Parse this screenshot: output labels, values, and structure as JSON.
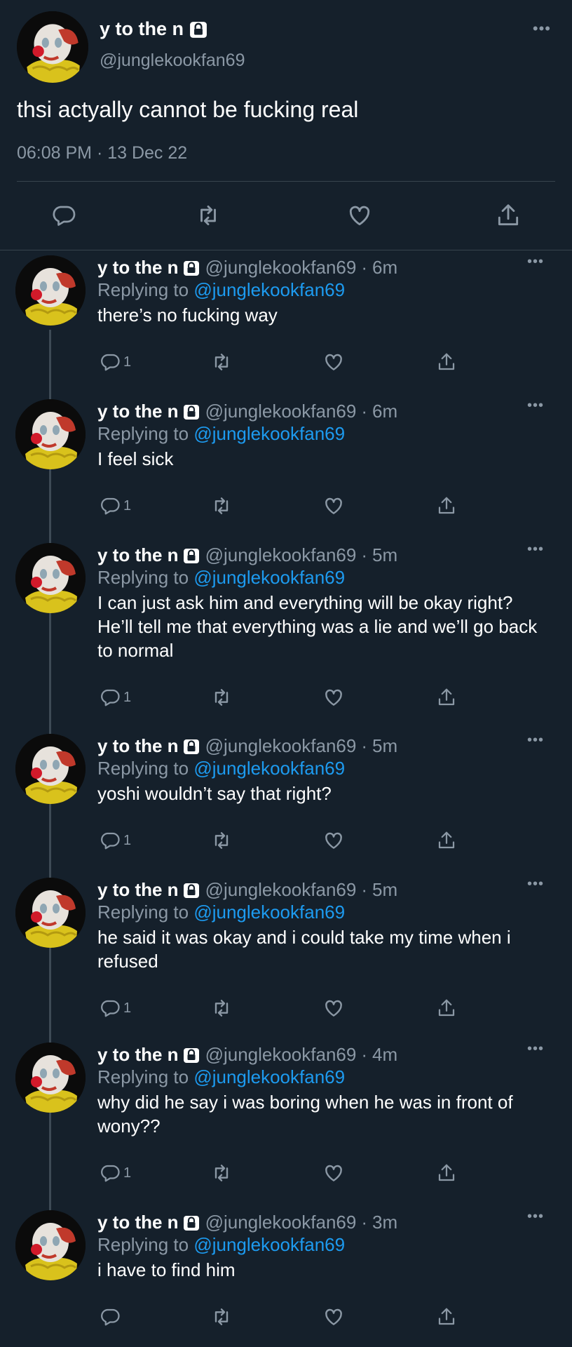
{
  "main_tweet": {
    "name": "y to the n",
    "handle": "@junglekookfan69",
    "text": "thsi actyally cannot be fucking real",
    "timestamp": "06:08 PM · 13 Dec 22",
    "icons": [
      "reply-icon",
      "retweet-icon",
      "like-icon",
      "share-icon",
      "lock-icon",
      "more-icon"
    ]
  },
  "replies": [
    {
      "name": "y to the n",
      "handle": "@junglekookfan69",
      "time": "6m",
      "replying_prefix": "Replying to",
      "replying_handle": "@junglekookfan69",
      "text": "there’s no fucking way",
      "reply_count": "1"
    },
    {
      "name": "y to the n",
      "handle": "@junglekookfan69",
      "time": "6m",
      "replying_prefix": "Replying to",
      "replying_handle": "@junglekookfan69",
      "text": "I feel sick",
      "reply_count": "1"
    },
    {
      "name": "y to the n",
      "handle": "@junglekookfan69",
      "time": "5m",
      "replying_prefix": "Replying to",
      "replying_handle": "@junglekookfan69",
      "text": "I can just ask him and everything will be okay right? He’ll tell me that everything was a lie and we’ll go back to normal",
      "reply_count": "1"
    },
    {
      "name": "y to the n",
      "handle": "@junglekookfan69",
      "time": "5m",
      "replying_prefix": "Replying to",
      "replying_handle": "@junglekookfan69",
      "text": "yoshi wouldn’t say that right?",
      "reply_count": "1"
    },
    {
      "name": "y to the n",
      "handle": "@junglekookfan69",
      "time": "5m",
      "replying_prefix": "Replying to",
      "replying_handle": "@junglekookfan69",
      "text": "he said it was okay and i could take my time when i refused",
      "reply_count": "1"
    },
    {
      "name": "y to the n",
      "handle": "@junglekookfan69",
      "time": "4m",
      "replying_prefix": "Replying to",
      "replying_handle": "@junglekookfan69",
      "text": "why did he say i was boring when he was in front of wony??",
      "reply_count": "1"
    },
    {
      "name": "y to the n",
      "handle": "@junglekookfan69",
      "time": "3m",
      "replying_prefix": "Replying to",
      "replying_handle": "@junglekookfan69",
      "text": "i have to find him",
      "reply_count": ""
    }
  ],
  "colors": {
    "background": "#15202b",
    "text_primary": "#ffffff",
    "text_secondary": "#8b98a5",
    "link": "#1d9bf0",
    "divider": "#38444d"
  }
}
